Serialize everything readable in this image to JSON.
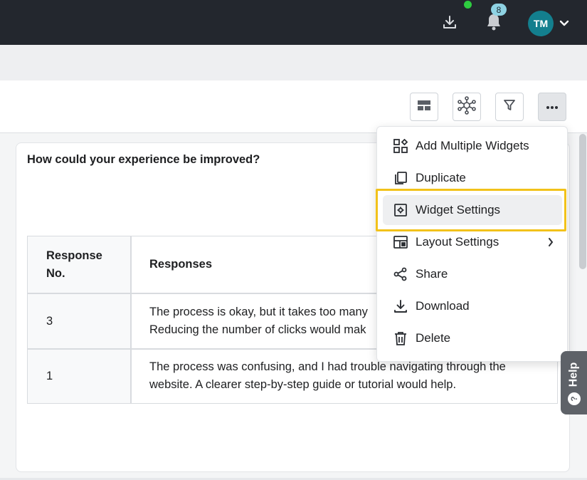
{
  "topbar": {
    "notification_count": "8",
    "avatar_initials": "TM",
    "icons": {
      "download": "download-icon",
      "bell": "bell-icon",
      "chevron": "chevron-down-icon"
    }
  },
  "toolbar": {
    "buttons": [
      "layout-icon",
      "network-icon",
      "filter-icon",
      "more-icon"
    ]
  },
  "widget": {
    "title": "How could your experience be improved?",
    "table": {
      "headers": [
        "Response No.",
        "Responses"
      ],
      "header_first_line1": "Response",
      "header_first_line2": "No.",
      "rows": [
        {
          "no": "3",
          "line1": "The process is okay, but it takes too many",
          "line2": "Reducing the number of clicks would mak"
        },
        {
          "no": "1",
          "line1": "The process was confusing, and I had trouble navigating through the",
          "line2": "website. A clearer step-by-step guide or tutorial would help."
        }
      ]
    }
  },
  "menu": {
    "items": [
      {
        "label": "Add Multiple Widgets",
        "icon": "widgets-icon"
      },
      {
        "label": "Duplicate",
        "icon": "copy-icon"
      },
      {
        "label": "Widget Settings",
        "icon": "settings-square-icon"
      },
      {
        "label": "Layout Settings",
        "icon": "layout-icon"
      },
      {
        "label": "Share",
        "icon": "share-icon"
      },
      {
        "label": "Download",
        "icon": "download-icon"
      },
      {
        "label": "Delete",
        "icon": "trash-icon"
      }
    ],
    "highlighted_index": 2
  },
  "help": {
    "label": "Help"
  },
  "colors": {
    "topbar": "#23272e",
    "avatar": "#137f8e",
    "badge": "#8ed2e3",
    "status_dot": "#2ecc40",
    "highlight": "#f2c21a"
  }
}
